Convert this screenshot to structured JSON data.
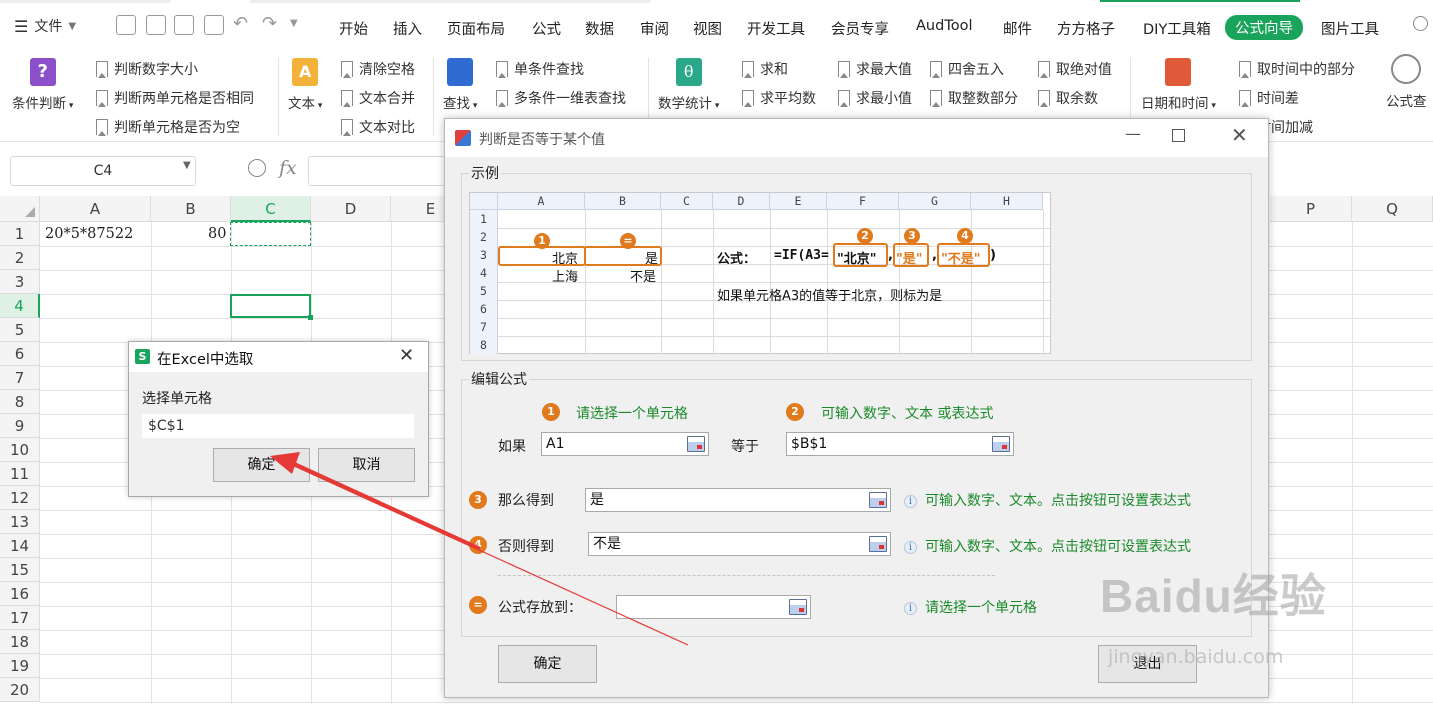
{
  "menu": {
    "file": "文件"
  },
  "tabs": [
    "开始",
    "插入",
    "页面布局",
    "公式",
    "数据",
    "审阅",
    "视图",
    "开发工具",
    "会员专享",
    "AudTool",
    "邮件",
    "方方格子",
    "DIY工具箱",
    "公式向导",
    "图片工具"
  ],
  "ribbon": {
    "cond_judge": "条件判断",
    "judge_items": [
      "判断数字大小",
      "判断两单元格是否相同",
      "判断单元格是否为空"
    ],
    "text_big": "文本",
    "text_items": [
      "清除空格",
      "文本合并",
      "文本对比"
    ],
    "find_big": "查找",
    "find_items": [
      "单条件查找",
      "多条件一维表查找"
    ],
    "math_big": "数学统计",
    "math_items": [
      "求和",
      "求平均数",
      "求最大值",
      "求最小值",
      "四舍五入",
      "取整数部分",
      "取绝对值",
      "取余数"
    ],
    "date_big": "日期和时间",
    "date_items": [
      "取时间中的部分",
      "时间差",
      "时间加减"
    ],
    "formula_lookup": "公式查"
  },
  "formula_bar": {
    "name_box": "C4",
    "fx": "fx"
  },
  "sheet": {
    "columns": [
      "A",
      "B",
      "C",
      "D",
      "E",
      "P",
      "Q"
    ],
    "rows": [
      "1",
      "2",
      "3",
      "4",
      "5",
      "6",
      "7",
      "8",
      "9",
      "10",
      "11",
      "12",
      "13",
      "14",
      "15",
      "16",
      "17",
      "18",
      "19",
      "20"
    ],
    "cells": {
      "A1": "20*5*87522",
      "B1": "80"
    }
  },
  "dialog": {
    "title": "判断是否等于某个值",
    "example_title": "示例",
    "example": {
      "cols": [
        "A",
        "B",
        "C",
        "D",
        "E",
        "F",
        "G",
        "H"
      ],
      "rows": [
        "1",
        "2",
        "3",
        "4",
        "5",
        "6",
        "7",
        "8"
      ],
      "a3": "北京",
      "b3": "是",
      "a4": "上海",
      "b4": "不是",
      "formula_label": "公式：",
      "formula_prefix": "=IF(A3=",
      "formula_arg2": "\"北京\"",
      "formula_arg3": "\"是\"",
      "formula_arg4": "\"不是\"",
      "formula_suffix": ")",
      "comma": ",",
      "desc": "如果单元格A3的值等于北京，则标为是",
      "badges": [
        "1",
        "=",
        "2",
        "3",
        "4"
      ]
    },
    "edit_title": "编辑公式",
    "step1": {
      "num": "1",
      "hint": "请选择一个单元格"
    },
    "step2": {
      "num": "2",
      "hint": "可输入数字、文本 或表达式"
    },
    "if_label": "如果",
    "if_value": "A1",
    "eq_label": "等于",
    "eq_value": "$B$1",
    "then": {
      "num": "3",
      "label": "那么得到",
      "value": "是",
      "hint": "可输入数字、文本。点击按钮可设置表达式"
    },
    "else": {
      "num": "4",
      "label": "否则得到",
      "value": "不是",
      "hint": "可输入数字、文本。点击按钮可设置表达式"
    },
    "store": {
      "num": "=",
      "label": "公式存放到：",
      "value": "",
      "hint": "请选择一个单元格"
    },
    "ok": "确定",
    "exit": "退出",
    "info_glyph": "i"
  },
  "pick_dialog": {
    "icon": "S",
    "title": "在Excel中选取",
    "label": "选择单元格",
    "value": "$C$1",
    "ok": "确定",
    "cancel": "取消"
  },
  "watermark": {
    "logo": "Baidu经验",
    "url": "jingyan.baidu.com"
  },
  "colors": {
    "accent": "#1aa35a",
    "orange": "#e07a1c",
    "hint_green": "#1a8a2a",
    "arrow_red": "#e53935"
  }
}
